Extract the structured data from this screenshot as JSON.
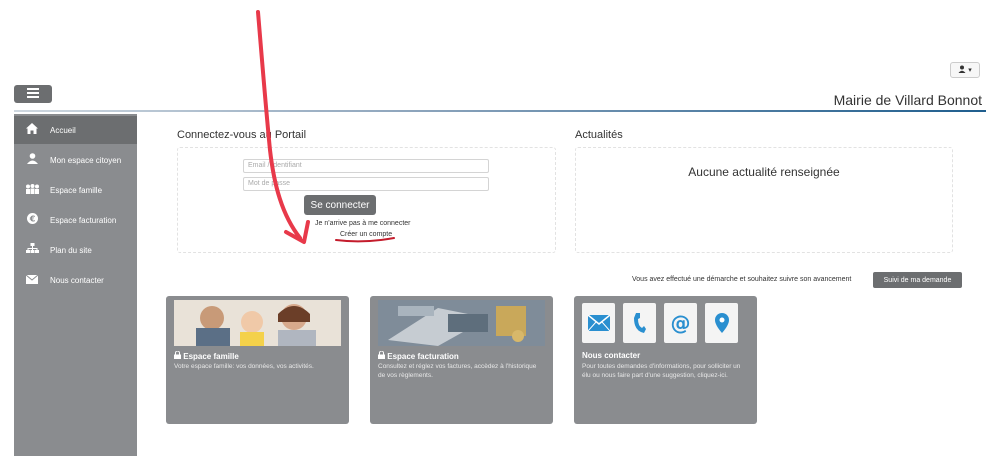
{
  "header": {
    "user_button_label": "⬤ ▾",
    "menu_icon": "hamburger-icon",
    "site_title": "Mairie de Villard Bonnot"
  },
  "sidebar": {
    "items": [
      {
        "label": "Accueil",
        "icon": "home-icon",
        "active": true
      },
      {
        "label": "Mon espace citoyen",
        "icon": "user-icon",
        "active": false
      },
      {
        "label": "Espace famille",
        "icon": "family-icon",
        "active": false
      },
      {
        "label": "Espace facturation",
        "icon": "euro-icon",
        "active": false
      },
      {
        "label": "Plan du site",
        "icon": "sitemap-icon",
        "active": false
      },
      {
        "label": "Nous contacter",
        "icon": "envelope-icon",
        "active": false
      }
    ]
  },
  "login": {
    "title": "Connectez-vous au Portail",
    "email_placeholder": "Email / Identifiant",
    "password_placeholder": "Mot de passe",
    "connect_label": "Se connecter",
    "cant_connect": "Je n'arrive pas à me connecter",
    "create_account": "Créer un compte"
  },
  "news": {
    "title": "Actualités",
    "empty": "Aucune actualité renseignée"
  },
  "follow": {
    "text": "Vous avez effectué une démarche et souhaitez suivre son avancement",
    "button": "Suivi de ma demande"
  },
  "cards": [
    {
      "title": "Espace famille",
      "desc": "Votre espace famille: vos données, vos activités."
    },
    {
      "title": "Espace facturation",
      "desc": "Consultez et réglez vos factures, accèdez à l'historique de vos règlements."
    },
    {
      "title": "Nous contacter",
      "desc": "Pour toutes demandes d'informations, pour solliciter un élu ou nous faire part d'une suggestion, cliquez-ici."
    }
  ],
  "colors": {
    "sidebar": "#8a8c8f",
    "button": "#6c6e70",
    "annotation": "#e8394a"
  }
}
